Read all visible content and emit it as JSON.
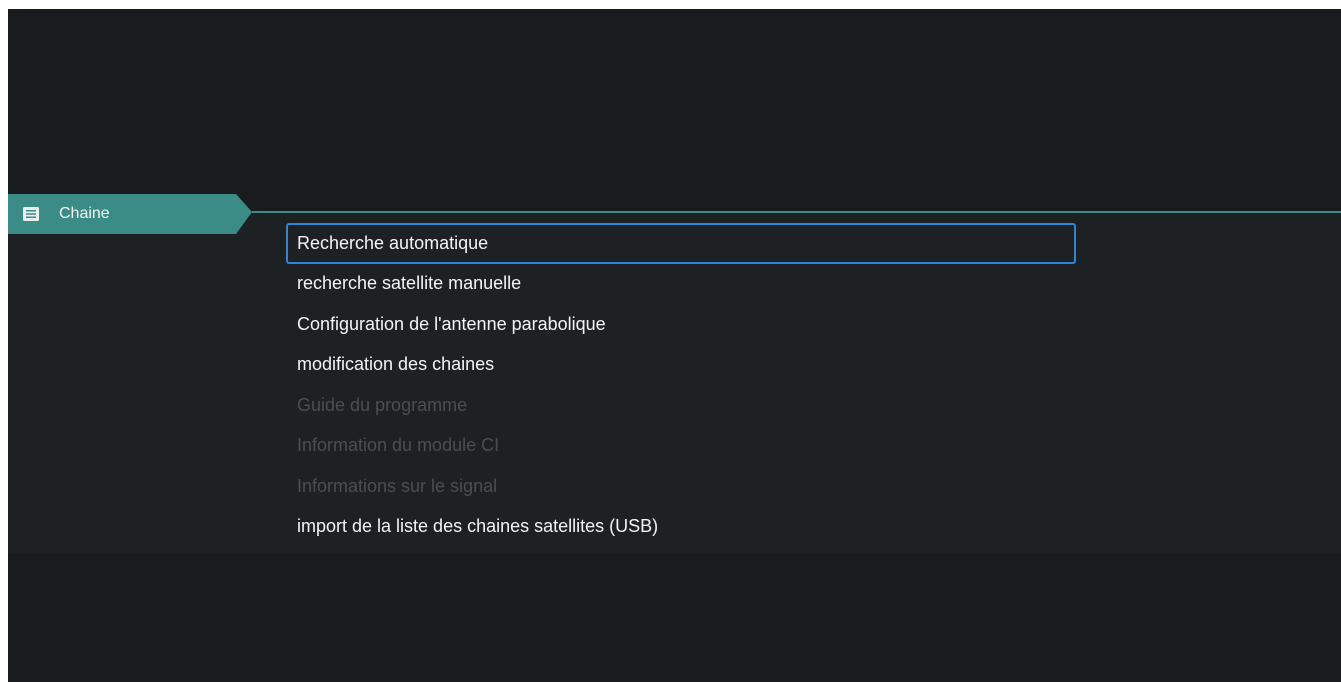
{
  "category": {
    "label": "Chaine",
    "icon": "list-icon",
    "color": "#3b8c87"
  },
  "menu": {
    "items": [
      {
        "label": "Recherche automatique",
        "state": "focused"
      },
      {
        "label": "recherche satellite manuelle",
        "state": "enabled"
      },
      {
        "label": "Configuration de l'antenne parabolique",
        "state": "enabled"
      },
      {
        "label": "modification des chaines",
        "state": "enabled"
      },
      {
        "label": "Guide du programme",
        "state": "disabled"
      },
      {
        "label": "Information du module CI",
        "state": "disabled"
      },
      {
        "label": "Informations sur le signal",
        "state": "disabled"
      },
      {
        "label": "import de la liste des chaines satellites (USB)",
        "state": "enabled"
      }
    ]
  },
  "colors": {
    "background": "#191c1f",
    "panel": "#1e2124",
    "accent": "#3b8c87",
    "focus_border": "#2d86d6",
    "text": "#f3f4f5",
    "text_disabled": "#4a4e53"
  }
}
